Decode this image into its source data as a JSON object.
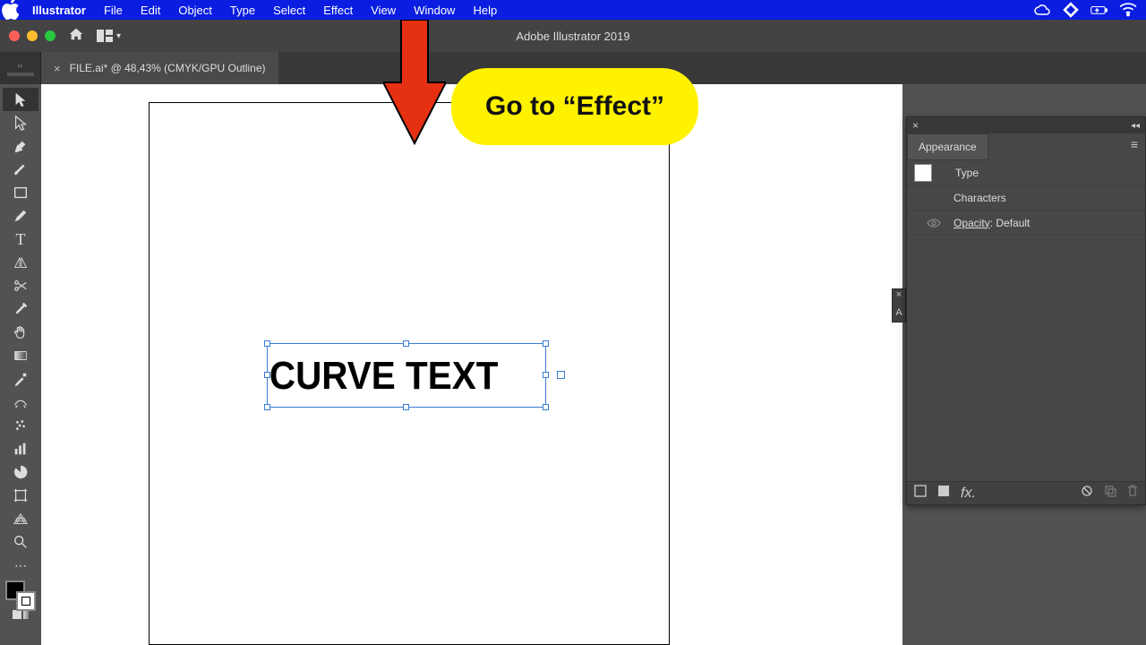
{
  "menubar": {
    "app_name": "Illustrator",
    "items": [
      "File",
      "Edit",
      "Object",
      "Type",
      "Select",
      "Effect",
      "View",
      "Window",
      "Help"
    ]
  },
  "appchrome": {
    "title": "Adobe Illustrator 2019"
  },
  "tab": {
    "label": "FILE.ai* @ 48,43% (CMYK/GPU Outline)"
  },
  "canvas": {
    "text_content": "CURVE TEXT"
  },
  "appearance_panel": {
    "title": "Appearance",
    "row_type": "Type",
    "row_characters": "Characters",
    "row_opacity_label": "Opacity",
    "row_opacity_value": ": Default"
  },
  "minitab": {
    "label": "A"
  },
  "callout": {
    "text": "Go to “Effect”"
  }
}
